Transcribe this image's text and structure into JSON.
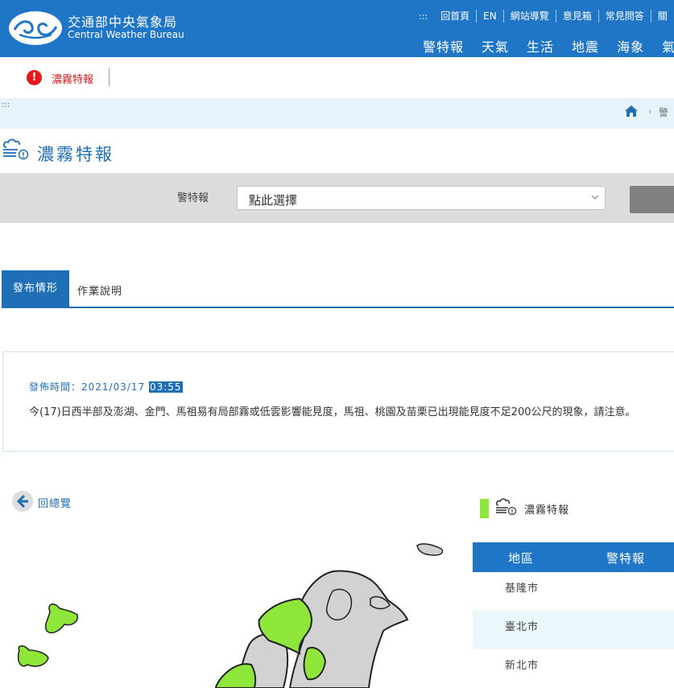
{
  "header": {
    "site_name_zh": "交通部中央氣象局",
    "site_name_en": "Central Weather Bureau",
    "toplinks_dots": ":::",
    "toplinks": [
      "回首頁",
      "EN",
      "網站導覽",
      "意見箱",
      "常見問答",
      "關"
    ],
    "nav": [
      "警特報",
      "天氣",
      "生活",
      "地震",
      "海象",
      "氣"
    ],
    "brand_color": "#1f76c7"
  },
  "alert_strip": {
    "label": "濃霧特報",
    "icon": "exclamation-icon"
  },
  "breadcrumb": {
    "dots": ":::",
    "current": "警"
  },
  "page": {
    "title": "濃霧特報",
    "icon": "fog-icon"
  },
  "filter": {
    "label": "警特報",
    "select_value": "點此選擇"
  },
  "tabs": [
    {
      "label": "發布情形",
      "active": true
    },
    {
      "label": "作業說明",
      "active": false
    }
  ],
  "bulletin": {
    "issue_prefix": "發佈時間：2021/03/17 ",
    "issue_time": "03:55",
    "text": "今(17)日西半部及澎湖、金門、馬祖易有局部霧或低雲影響能見度，馬祖、桃園及苗栗已出現能見度不足200公尺的現象，請注意。"
  },
  "back_link": {
    "label": "回總覽"
  },
  "legend": {
    "label": "濃霧特報",
    "color": "#8ee63b"
  },
  "table": {
    "headers": [
      "地區",
      "警特報"
    ],
    "rows": [
      "基隆市",
      "臺北市",
      "新北市"
    ]
  }
}
